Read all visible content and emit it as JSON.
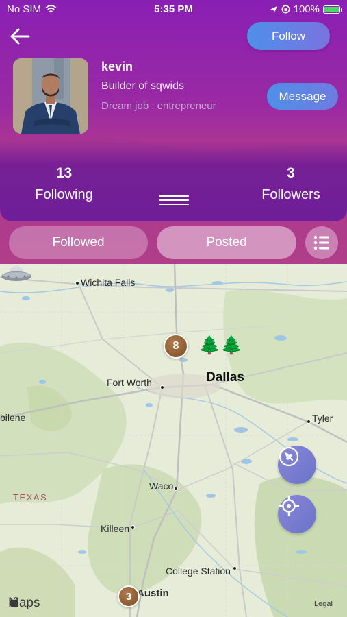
{
  "status_bar": {
    "carrier": "No SIM",
    "time": "5:35 PM",
    "battery": "100%"
  },
  "header": {
    "follow_label": "Follow",
    "message_label": "Message"
  },
  "profile": {
    "name": "kevin",
    "bio": "Builder of sqwids",
    "dream_job": "Dream job : entrepreneur"
  },
  "stats": {
    "following_count": "13",
    "following_label": "Following",
    "followers_count": "3",
    "followers_label": "Followers"
  },
  "tabs": [
    {
      "label": "Followed",
      "active": false
    },
    {
      "label": "Posted",
      "active": true
    }
  ],
  "map": {
    "region_label": "TEXAS",
    "cities": {
      "wichita_falls": "Wichita Falls",
      "fort_worth": "Fort Worth",
      "dallas": "Dallas",
      "abilene": "bilene",
      "tyler": "Tyler",
      "waco": "Waco",
      "killeen": "Killeen",
      "college_station": "College Station",
      "austin": "Austin"
    },
    "clusters": [
      {
        "count": "8"
      },
      {
        "count": "3"
      }
    ],
    "attribution": "Maps",
    "legal": "Legal"
  },
  "icons": {
    "back": "arrow-left-icon",
    "list": "list-icon",
    "compass": "compass-icon",
    "locate": "crosshair-icon"
  }
}
